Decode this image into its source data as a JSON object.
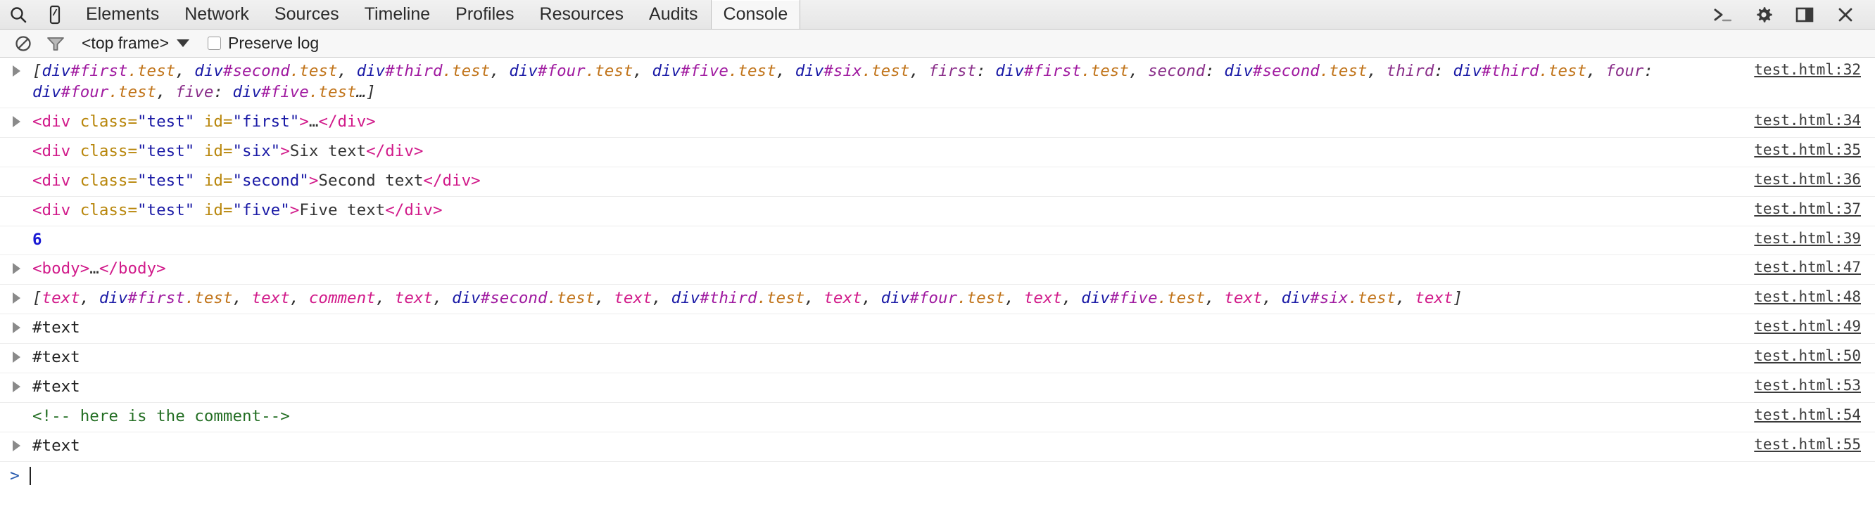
{
  "tabbar": {
    "icons": [
      {
        "name": "search-icon",
        "label": "Search"
      },
      {
        "name": "device-mode-icon",
        "label": "Toggle device mode"
      }
    ],
    "tabs": [
      {
        "label": "Elements",
        "selected": false
      },
      {
        "label": "Network",
        "selected": false
      },
      {
        "label": "Sources",
        "selected": false
      },
      {
        "label": "Timeline",
        "selected": false
      },
      {
        "label": "Profiles",
        "selected": false
      },
      {
        "label": "Resources",
        "selected": false
      },
      {
        "label": "Audits",
        "selected": false
      },
      {
        "label": "Console",
        "selected": true
      }
    ],
    "right_icons": [
      {
        "name": "console-drawer-icon",
        "label": "Show console drawer"
      },
      {
        "name": "gear-icon",
        "label": "Settings"
      },
      {
        "name": "dock-panel-icon",
        "label": "Dock side"
      },
      {
        "name": "close-icon",
        "label": "Close DevTools"
      }
    ]
  },
  "filterbar": {
    "clear_icon": "clear-console-icon",
    "filter_icon": "filter-funnel-icon",
    "frame_label": "<top frame>",
    "preserve_label": "Preserve log",
    "preserve_checked": false
  },
  "console": {
    "rows": [
      {
        "id": "row-array-elements",
        "expandable": true,
        "source": "test.html:32",
        "kind": "object-preview",
        "tokens": [
          {
            "t": "[",
            "c": "t-punct"
          },
          {
            "t": "div",
            "c": "t-tag"
          },
          {
            "t": "#first",
            "c": "t-id"
          },
          {
            "t": ".test",
            "c": "t-cls"
          },
          {
            "t": ", ",
            "c": "t-punct"
          },
          {
            "t": "div",
            "c": "t-tag"
          },
          {
            "t": "#second",
            "c": "t-id"
          },
          {
            "t": ".test",
            "c": "t-cls"
          },
          {
            "t": ", ",
            "c": "t-punct"
          },
          {
            "t": "div",
            "c": "t-tag"
          },
          {
            "t": "#third",
            "c": "t-id"
          },
          {
            "t": ".test",
            "c": "t-cls"
          },
          {
            "t": ", ",
            "c": "t-punct"
          },
          {
            "t": "div",
            "c": "t-tag"
          },
          {
            "t": "#four",
            "c": "t-id"
          },
          {
            "t": ".test",
            "c": "t-cls"
          },
          {
            "t": ", ",
            "c": "t-punct"
          },
          {
            "t": "div",
            "c": "t-tag"
          },
          {
            "t": "#five",
            "c": "t-id"
          },
          {
            "t": ".test",
            "c": "t-cls"
          },
          {
            "t": ", ",
            "c": "t-punct"
          },
          {
            "t": "div",
            "c": "t-tag"
          },
          {
            "t": "#six",
            "c": "t-id"
          },
          {
            "t": ".test",
            "c": "t-cls"
          },
          {
            "t": ", ",
            "c": "t-punct"
          },
          {
            "t": "first",
            "c": "t-key"
          },
          {
            "t": ": ",
            "c": "t-punct"
          },
          {
            "t": "div",
            "c": "t-tag"
          },
          {
            "t": "#first",
            "c": "t-id"
          },
          {
            "t": ".test",
            "c": "t-cls"
          },
          {
            "t": ", ",
            "c": "t-punct"
          },
          {
            "t": "second",
            "c": "t-key"
          },
          {
            "t": ": ",
            "c": "t-punct"
          },
          {
            "t": "div",
            "c": "t-tag"
          },
          {
            "t": "#second",
            "c": "t-id"
          },
          {
            "t": ".test",
            "c": "t-cls"
          },
          {
            "t": ", ",
            "c": "t-punct"
          },
          {
            "t": "third",
            "c": "t-key"
          },
          {
            "t": ": ",
            "c": "t-punct"
          },
          {
            "t": "div",
            "c": "t-tag"
          },
          {
            "t": "#third",
            "c": "t-id"
          },
          {
            "t": ".test",
            "c": "t-cls"
          },
          {
            "t": ", ",
            "c": "t-punct"
          },
          {
            "t": "four",
            "c": "t-key"
          },
          {
            "t": ": ",
            "c": "t-punct"
          },
          {
            "t": "div",
            "c": "t-tag"
          },
          {
            "t": "#four",
            "c": "t-id"
          },
          {
            "t": ".test",
            "c": "t-cls"
          },
          {
            "t": ", ",
            "c": "t-punct"
          },
          {
            "t": "five",
            "c": "t-key"
          },
          {
            "t": ": ",
            "c": "t-punct"
          },
          {
            "t": "div",
            "c": "t-tag"
          },
          {
            "t": "#five",
            "c": "t-id"
          },
          {
            "t": ".test",
            "c": "t-cls"
          },
          {
            "t": "…]",
            "c": "t-punct"
          }
        ]
      },
      {
        "id": "row-div-first",
        "expandable": true,
        "source": "test.html:34",
        "kind": "dom-element",
        "tokens": [
          {
            "t": "<div",
            "c": "d-tag"
          },
          {
            "t": " ",
            "c": "d-plain"
          },
          {
            "t": "class=",
            "c": "d-attr"
          },
          {
            "t": "\"test\"",
            "c": "d-val"
          },
          {
            "t": " ",
            "c": "d-plain"
          },
          {
            "t": "id=",
            "c": "d-attr"
          },
          {
            "t": "\"first\"",
            "c": "d-val"
          },
          {
            "t": ">",
            "c": "d-tag"
          },
          {
            "t": "…",
            "c": "d-text"
          },
          {
            "t": "</div>",
            "c": "d-tag"
          }
        ]
      },
      {
        "id": "row-div-six",
        "expandable": false,
        "source": "test.html:35",
        "kind": "dom-element",
        "tokens": [
          {
            "t": "<div",
            "c": "d-tag"
          },
          {
            "t": " ",
            "c": "d-plain"
          },
          {
            "t": "class=",
            "c": "d-attr"
          },
          {
            "t": "\"test\"",
            "c": "d-val"
          },
          {
            "t": " ",
            "c": "d-plain"
          },
          {
            "t": "id=",
            "c": "d-attr"
          },
          {
            "t": "\"six\"",
            "c": "d-val"
          },
          {
            "t": ">",
            "c": "d-tag"
          },
          {
            "t": "Six text",
            "c": "d-text"
          },
          {
            "t": "</div>",
            "c": "d-tag"
          }
        ]
      },
      {
        "id": "row-div-second",
        "expandable": false,
        "source": "test.html:36",
        "kind": "dom-element",
        "tokens": [
          {
            "t": "<div",
            "c": "d-tag"
          },
          {
            "t": " ",
            "c": "d-plain"
          },
          {
            "t": "class=",
            "c": "d-attr"
          },
          {
            "t": "\"test\"",
            "c": "d-val"
          },
          {
            "t": " ",
            "c": "d-plain"
          },
          {
            "t": "id=",
            "c": "d-attr"
          },
          {
            "t": "\"second\"",
            "c": "d-val"
          },
          {
            "t": ">",
            "c": "d-tag"
          },
          {
            "t": "Second text",
            "c": "d-text"
          },
          {
            "t": "</div>",
            "c": "d-tag"
          }
        ]
      },
      {
        "id": "row-div-five",
        "expandable": false,
        "source": "test.html:37",
        "kind": "dom-element",
        "tokens": [
          {
            "t": "<div",
            "c": "d-tag"
          },
          {
            "t": " ",
            "c": "d-plain"
          },
          {
            "t": "class=",
            "c": "d-attr"
          },
          {
            "t": "\"test\"",
            "c": "d-val"
          },
          {
            "t": " ",
            "c": "d-plain"
          },
          {
            "t": "id=",
            "c": "d-attr"
          },
          {
            "t": "\"five\"",
            "c": "d-val"
          },
          {
            "t": ">",
            "c": "d-tag"
          },
          {
            "t": "Five text",
            "c": "d-text"
          },
          {
            "t": "</div>",
            "c": "d-tag"
          }
        ]
      },
      {
        "id": "row-number-6",
        "expandable": false,
        "source": "test.html:39",
        "kind": "number",
        "tokens": [
          {
            "t": "6",
            "c": "d-num"
          }
        ]
      },
      {
        "id": "row-body",
        "expandable": true,
        "source": "test.html:47",
        "kind": "dom-element",
        "tokens": [
          {
            "t": "<body>",
            "c": "d-tag"
          },
          {
            "t": "…",
            "c": "d-text"
          },
          {
            "t": "</body>",
            "c": "d-tag"
          }
        ]
      },
      {
        "id": "row-array-childnodes",
        "expandable": true,
        "source": "test.html:48",
        "kind": "object-preview",
        "tokens": [
          {
            "t": "[",
            "c": "t-punct"
          },
          {
            "t": "text",
            "c": "t-node"
          },
          {
            "t": ", ",
            "c": "t-punct"
          },
          {
            "t": "div",
            "c": "t-tag"
          },
          {
            "t": "#first",
            "c": "t-id"
          },
          {
            "t": ".test",
            "c": "t-cls"
          },
          {
            "t": ", ",
            "c": "t-punct"
          },
          {
            "t": "text",
            "c": "t-node"
          },
          {
            "t": ", ",
            "c": "t-punct"
          },
          {
            "t": "comment",
            "c": "t-node"
          },
          {
            "t": ", ",
            "c": "t-punct"
          },
          {
            "t": "text",
            "c": "t-node"
          },
          {
            "t": ", ",
            "c": "t-punct"
          },
          {
            "t": "div",
            "c": "t-tag"
          },
          {
            "t": "#second",
            "c": "t-id"
          },
          {
            "t": ".test",
            "c": "t-cls"
          },
          {
            "t": ", ",
            "c": "t-punct"
          },
          {
            "t": "text",
            "c": "t-node"
          },
          {
            "t": ", ",
            "c": "t-punct"
          },
          {
            "t": "div",
            "c": "t-tag"
          },
          {
            "t": "#third",
            "c": "t-id"
          },
          {
            "t": ".test",
            "c": "t-cls"
          },
          {
            "t": ", ",
            "c": "t-punct"
          },
          {
            "t": "text",
            "c": "t-node"
          },
          {
            "t": ", ",
            "c": "t-punct"
          },
          {
            "t": "div",
            "c": "t-tag"
          },
          {
            "t": "#four",
            "c": "t-id"
          },
          {
            "t": ".test",
            "c": "t-cls"
          },
          {
            "t": ", ",
            "c": "t-punct"
          },
          {
            "t": "text",
            "c": "t-node"
          },
          {
            "t": ", ",
            "c": "t-punct"
          },
          {
            "t": "div",
            "c": "t-tag"
          },
          {
            "t": "#five",
            "c": "t-id"
          },
          {
            "t": ".test",
            "c": "t-cls"
          },
          {
            "t": ", ",
            "c": "t-punct"
          },
          {
            "t": "text",
            "c": "t-node"
          },
          {
            "t": ", ",
            "c": "t-punct"
          },
          {
            "t": "div",
            "c": "t-tag"
          },
          {
            "t": "#six",
            "c": "t-id"
          },
          {
            "t": ".test",
            "c": "t-cls"
          },
          {
            "t": ", ",
            "c": "t-punct"
          },
          {
            "t": "text",
            "c": "t-node"
          },
          {
            "t": "]",
            "c": "t-punct"
          }
        ]
      },
      {
        "id": "row-text-49",
        "expandable": true,
        "source": "test.html:49",
        "kind": "dom-text-node",
        "tokens": [
          {
            "t": "#text",
            "c": "d-plain"
          }
        ]
      },
      {
        "id": "row-text-50",
        "expandable": true,
        "source": "test.html:50",
        "kind": "dom-text-node",
        "tokens": [
          {
            "t": "#text",
            "c": "d-plain"
          }
        ]
      },
      {
        "id": "row-text-53",
        "expandable": true,
        "source": "test.html:53",
        "kind": "dom-text-node",
        "tokens": [
          {
            "t": "#text",
            "c": "d-plain"
          }
        ]
      },
      {
        "id": "row-comment",
        "expandable": false,
        "source": "test.html:54",
        "kind": "dom-comment",
        "tokens": [
          {
            "t": "<!-- here is the comment-->",
            "c": "d-cmt"
          }
        ]
      },
      {
        "id": "row-text-55",
        "expandable": true,
        "source": "test.html:55",
        "kind": "dom-text-node",
        "tokens": [
          {
            "t": "#text",
            "c": "d-plain"
          }
        ]
      }
    ],
    "prompt": {
      "arrow": ">",
      "value": ""
    }
  }
}
